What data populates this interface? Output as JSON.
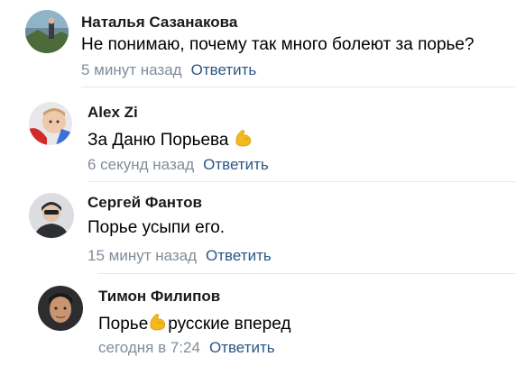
{
  "comments": [
    {
      "author": "Наталья Сазанакова",
      "text": "Не понимаю, почему так много болеют за порье?",
      "time": "5 минут назад",
      "reply": "Ответить"
    },
    {
      "author": "Alex Zi",
      "text_before": "За Даню Порьева",
      "emoji": "flexed-biceps",
      "time": "6 секунд назад",
      "reply": "Ответить"
    },
    {
      "author": "Сергей Фантов",
      "text": "Порье усыпи его.",
      "time": "15 минут назад",
      "reply": "Ответить"
    },
    {
      "author": "Тимон Филипов",
      "text_before": "Порье",
      "emoji": "flexed-biceps",
      "text_after": "русские вперед",
      "time": "сегодня в 7:24",
      "reply": "Ответить"
    }
  ],
  "colors": {
    "link": "#2a5885",
    "meta": "#818c99",
    "divider": "#e7e8ec",
    "emoji": "#f5b81e"
  }
}
